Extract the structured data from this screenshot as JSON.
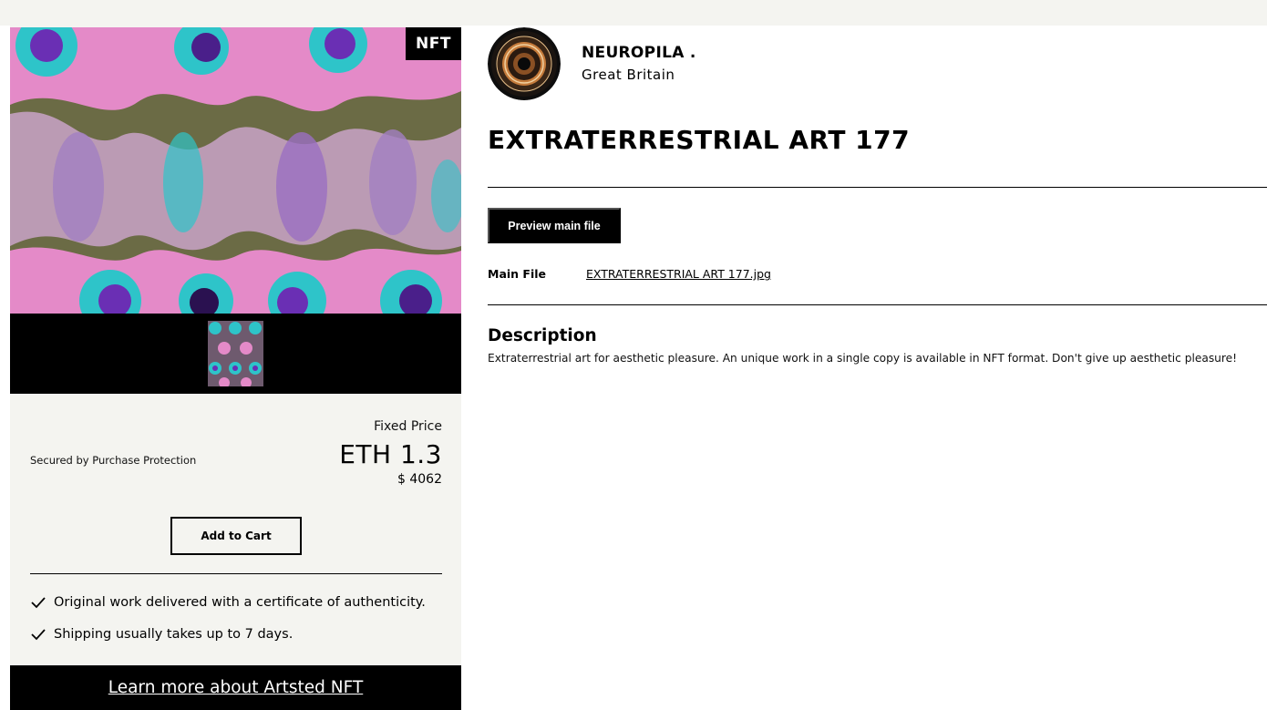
{
  "badge": {
    "label": "NFT"
  },
  "purchase": {
    "secured_text": "Secured by Purchase Protection",
    "price_type": "Fixed Price",
    "price_eth": "ETH 1.3",
    "price_usd": "$ 4062",
    "add_to_cart_label": "Add to Cart"
  },
  "features": [
    {
      "icon": "check-icon",
      "text": "Original work delivered with a certificate of authenticity."
    },
    {
      "icon": "check-icon",
      "text": "Shipping usually takes up to 7 days."
    }
  ],
  "learn_more": {
    "label": "Learn more about Artsted NFT"
  },
  "artist": {
    "name": "NEUROPILA .",
    "country": "Great Britain"
  },
  "artwork": {
    "title": "EXTRATERRESTRIAL ART 177",
    "preview_label": "Preview main file",
    "main_file_label": "Main File",
    "main_file_name": "EXTRATERRESTRIAL ART 177.jpg"
  },
  "description": {
    "heading": "Description",
    "text": "Extraterrestrial art for aesthetic pleasure. An unique work in a single copy is available in NFT format. Don't give up aesthetic pleasure!"
  },
  "colors": {
    "panel_bg": "#f4f4f0",
    "accent": "#000000",
    "art_pink": "#e48ac8",
    "art_teal": "#2ec4c9",
    "art_olive": "#6b6b45",
    "art_purple": "#6a2fb4"
  }
}
